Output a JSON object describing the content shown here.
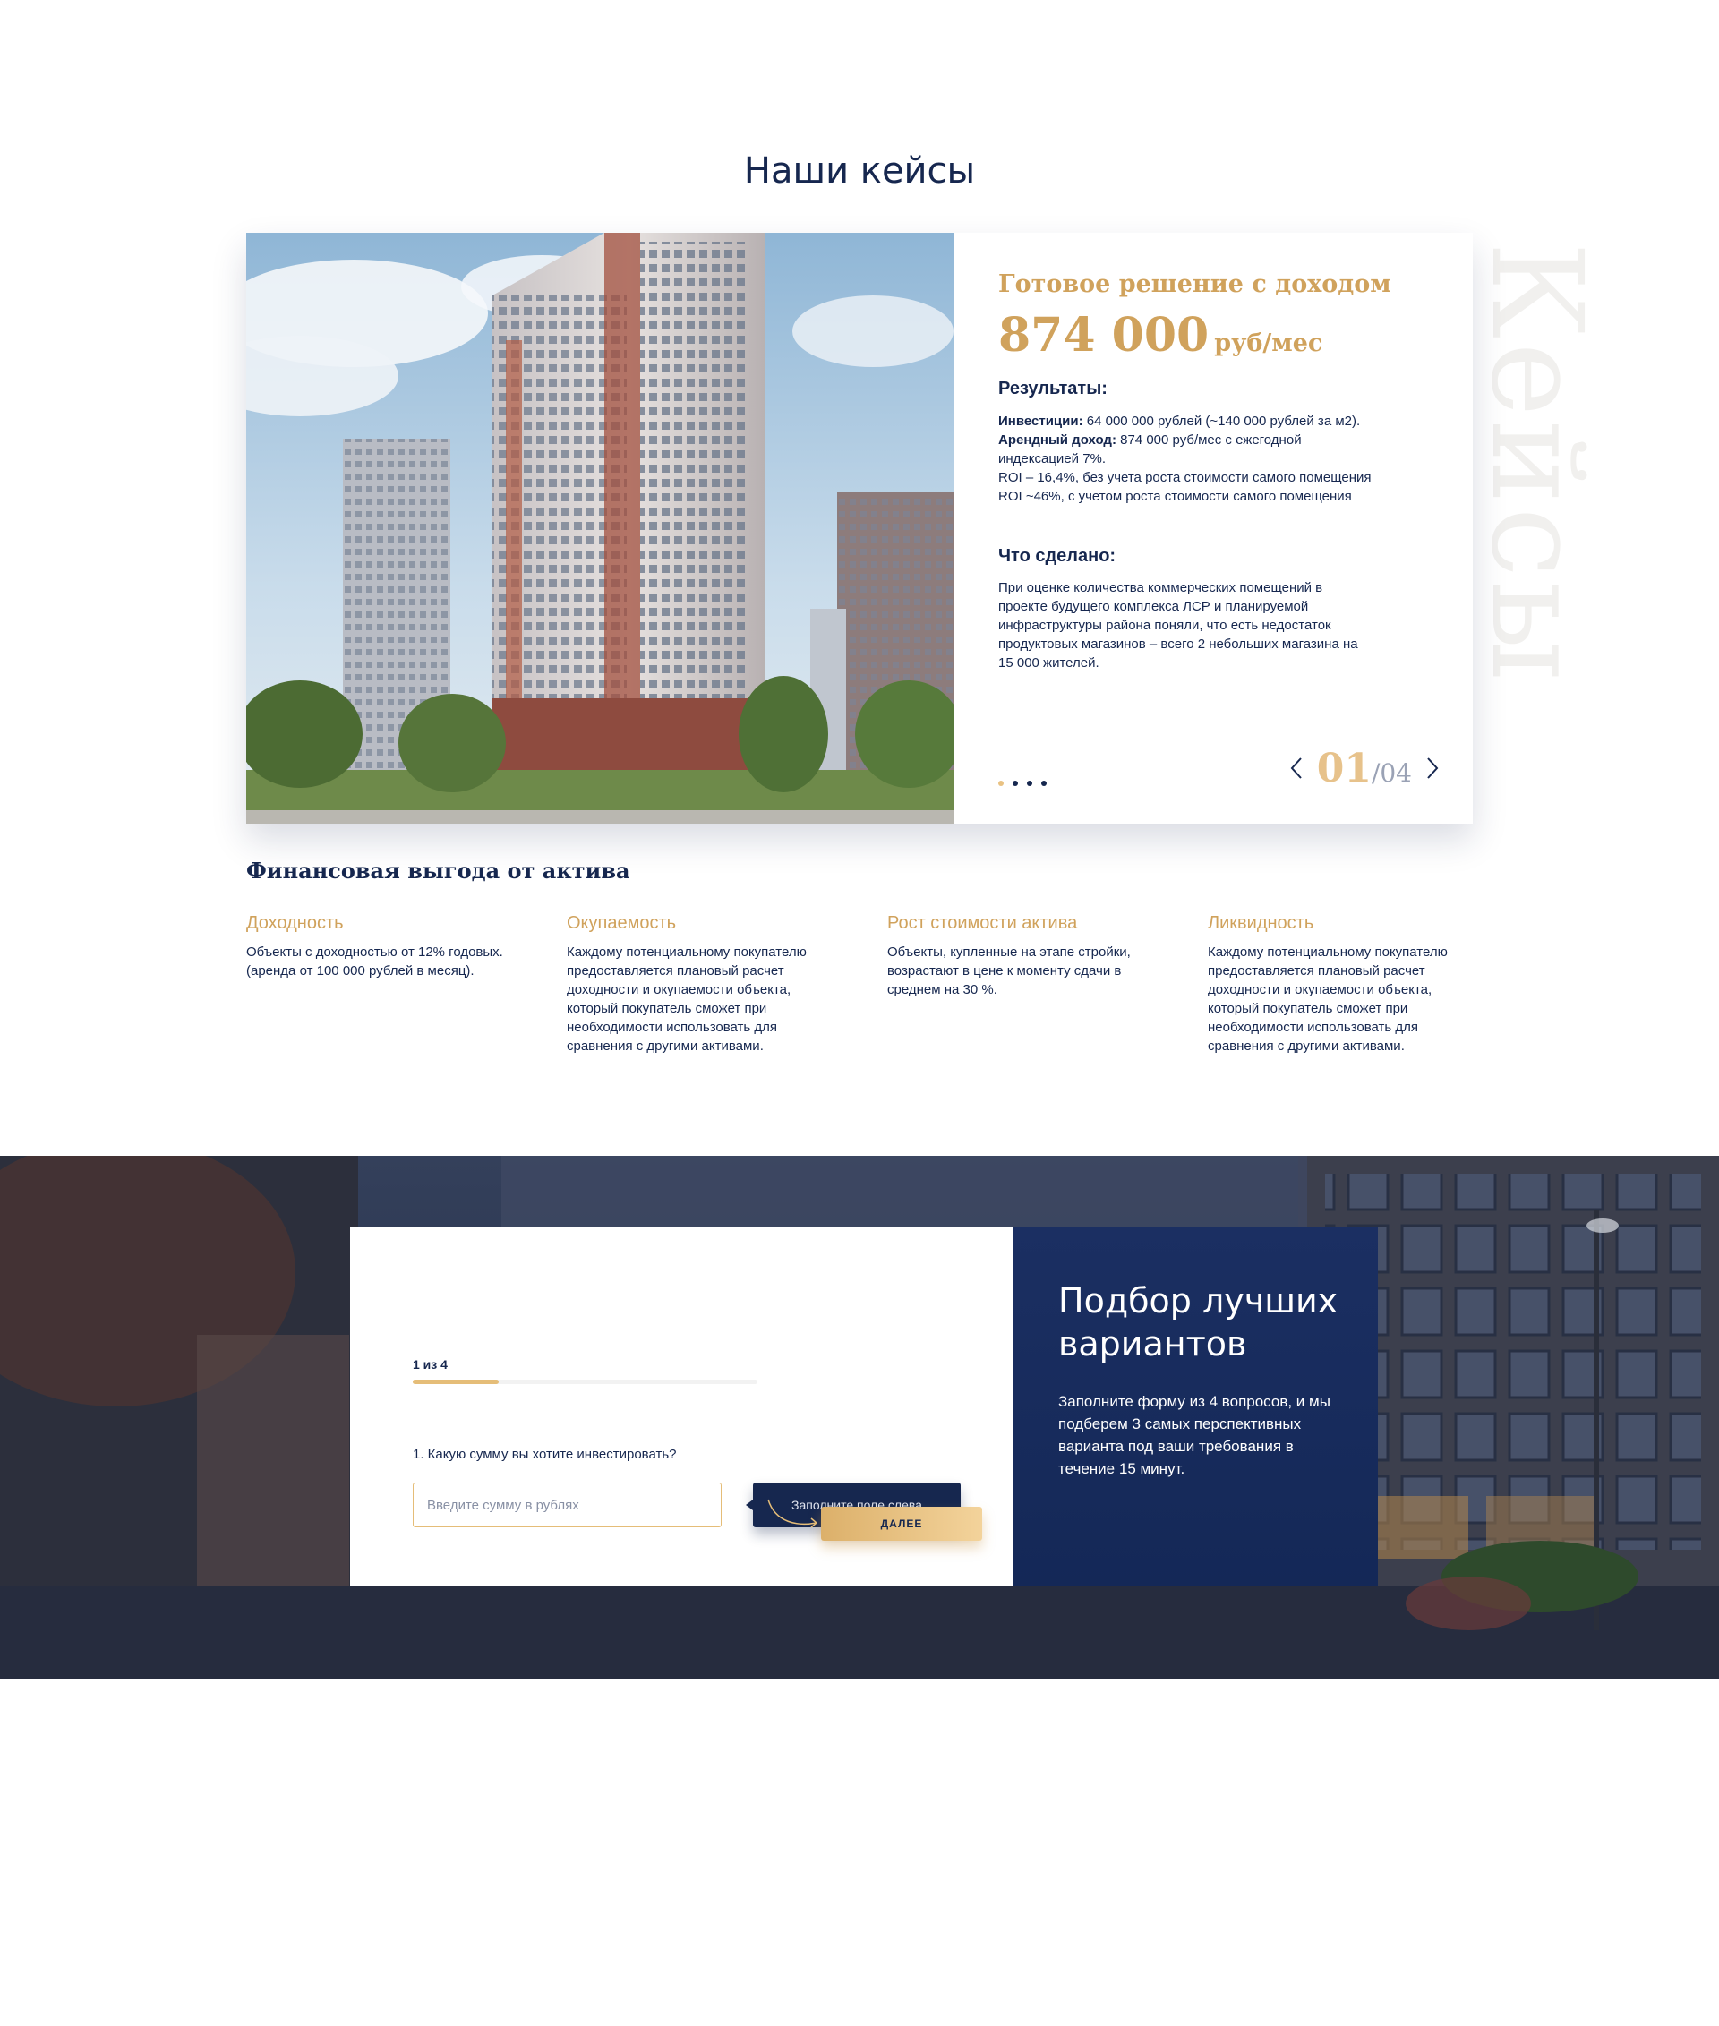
{
  "section_title": "Наши кейсы",
  "watermark": "Кейсы",
  "case": {
    "heading": "Готовое решение с доходом",
    "price": "874 000",
    "price_unit": "руб/мес",
    "results_title": "Результаты:",
    "investments_label": "Инвестиции:",
    "investments_value": "64 000 000 рублей (~140 000 рублей за м2).",
    "rent_label": "Арендный доход:",
    "rent_value": "874 000 руб/мес с ежегодной индексацией 7%.",
    "roi_1": "ROI – 16,4%, без учета роста стоимости самого помещения",
    "roi_2": "ROI ~46%, с учетом роста стоимости самого помещения",
    "done_title": "Что сделано:",
    "done_text": "При оценке количества коммерческих помещений в проекте будущего комплекса ЛСР и планируемой инфраструктуры района поняли, что есть недостаток продуктовых магазинов – всего 2 небольших магазина на 15 000 жителей.",
    "pager_current": "01",
    "pager_total": "/04",
    "dots_total": 4,
    "active_dot": 0
  },
  "benefits": {
    "title": "Финансовая выгода от актива",
    "items": [
      {
        "title": "Доходность",
        "text": "Объекты с доходностью от 12% годовых. (аренда от 100 000 рублей в месяц)."
      },
      {
        "title": "Окупаемость",
        "text": "Каждому потенциальному покупателю предоставляется плановый расчет доходности и окупаемости объекта, который покупатель сможет при необходимости использовать для сравнения с другими активами."
      },
      {
        "title": "Рост стоимости актива",
        "text": "Объекты, купленные на этапе стройки, возрастают в цене к моменту сдачи в среднем на 30 %."
      },
      {
        "title": "Ликвидность",
        "text": "Каждому потенциальному покупателю предоставляется плановый расчет доходности и окупаемости объекта, который покупатель сможет при необходимости использовать для сравнения с другими активами."
      }
    ]
  },
  "form": {
    "step_label": "1 из 4",
    "progress": 0.25,
    "question": "1. Какую сумму вы хотите инвестировать?",
    "input_placeholder": "Введите сумму в рублях",
    "input_value": "",
    "hint_label": "Заполните поле слева",
    "next_label": "ДАЛЕЕ"
  },
  "promo": {
    "title": "Подбор лучших вариантов",
    "text": "Заполните форму из 4 вопросов, и мы подберем 3 самых перспективных  варианта под ваши требования в течение 15 минут."
  },
  "colors": {
    "navy": "#16274f",
    "gold": "#d0a25c",
    "gold_light": "#e7c28b"
  }
}
